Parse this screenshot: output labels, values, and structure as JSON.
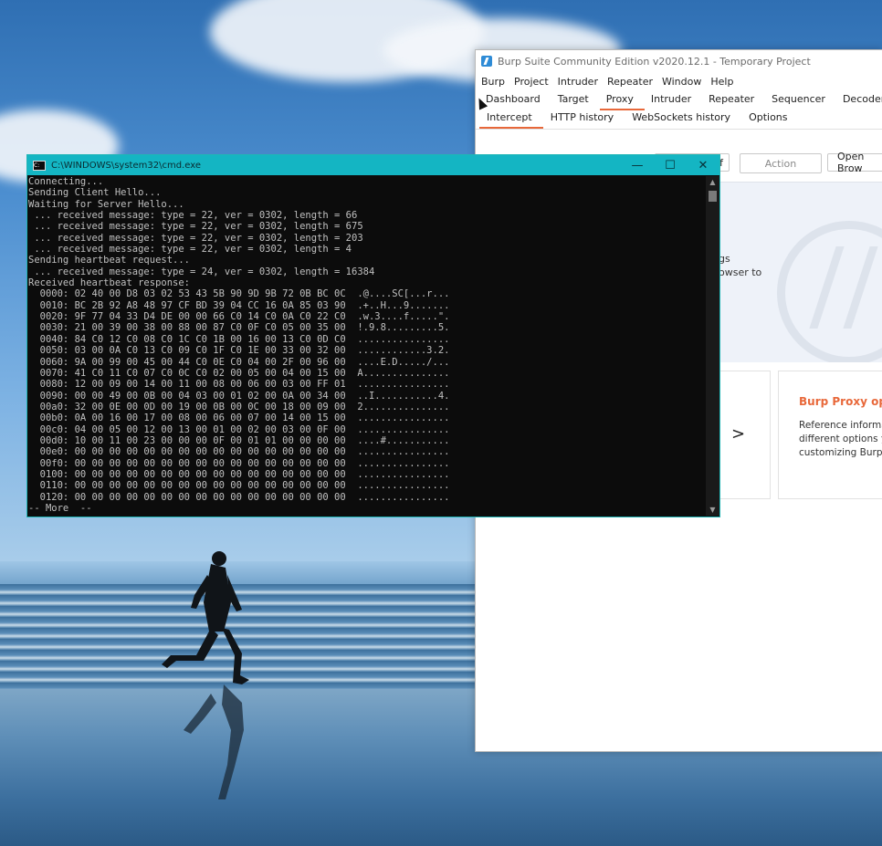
{
  "burp": {
    "title": "Burp Suite Community Edition v2020.12.1 - Temporary Project",
    "menu": [
      "Burp",
      "Project",
      "Intruder",
      "Repeater",
      "Window",
      "Help"
    ],
    "tabs": [
      "Dashboard",
      "Target",
      "Proxy",
      "Intruder",
      "Repeater",
      "Sequencer",
      "Decoder"
    ],
    "active_tab": "Proxy",
    "subtabs": [
      "Intercept",
      "HTTP history",
      "WebSockets history",
      "Options"
    ],
    "active_subtab": "Intercept",
    "toolbar": {
      "intercept_toggle": "ff",
      "action": "Action",
      "open_browser": "Open Brow"
    },
    "intercept_text": [
      "gs",
      "owser to"
    ],
    "card_arrow": ">",
    "card": {
      "title": "Burp Proxy optic",
      "body": [
        "Reference informati",
        "different options yo",
        "customizing Burp P"
      ]
    },
    "accent_color": "#e8683a"
  },
  "cmd": {
    "title": "C:\\WINDOWS\\system32\\cmd.exe",
    "controls": [
      "—",
      "☐",
      "✕"
    ],
    "lines": [
      "Connecting...",
      "Sending Client Hello...",
      "Waiting for Server Hello...",
      " ... received message: type = 22, ver = 0302, length = 66",
      " ... received message: type = 22, ver = 0302, length = 675",
      " ... received message: type = 22, ver = 0302, length = 203",
      " ... received message: type = 22, ver = 0302, length = 4",
      "Sending heartbeat request...",
      " ... received message: type = 24, ver = 0302, length = 16384",
      "Received heartbeat response:",
      "  0000: 02 40 00 D8 03 02 53 43 5B 90 9D 9B 72 0B BC 0C  .@....SC[...r...",
      "  0010: BC 2B 92 A8 48 97 CF BD 39 04 CC 16 0A 85 03 90  .+..H...9.......",
      "  0020: 9F 77 04 33 D4 DE 00 00 66 C0 14 C0 0A C0 22 C0  .w.3....f.....\".",
      "  0030: 21 00 39 00 38 00 88 00 87 C0 0F C0 05 00 35 00  !.9.8.........5.",
      "  0040: 84 C0 12 C0 08 C0 1C C0 1B 00 16 00 13 C0 0D C0  ................",
      "  0050: 03 00 0A C0 13 C0 09 C0 1F C0 1E 00 33 00 32 00  ............3.2.",
      "  0060: 9A 00 99 00 45 00 44 C0 0E C0 04 00 2F 00 96 00  ....E.D...../...",
      "  0070: 41 C0 11 C0 07 C0 0C C0 02 00 05 00 04 00 15 00  A...............",
      "  0080: 12 00 09 00 14 00 11 00 08 00 06 00 03 00 FF 01  ................",
      "  0090: 00 00 49 00 0B 00 04 03 00 01 02 00 0A 00 34 00  ..I...........4.",
      "  00a0: 32 00 0E 00 0D 00 19 00 0B 00 0C 00 18 00 09 00  2...............",
      "  00b0: 0A 00 16 00 17 00 08 00 06 00 07 00 14 00 15 00  ................",
      "  00c0: 04 00 05 00 12 00 13 00 01 00 02 00 03 00 0F 00  ................",
      "  00d0: 10 00 11 00 23 00 00 00 0F 00 01 01 00 00 00 00  ....#...........",
      "  00e0: 00 00 00 00 00 00 00 00 00 00 00 00 00 00 00 00  ................",
      "  00f0: 00 00 00 00 00 00 00 00 00 00 00 00 00 00 00 00  ................",
      "  0100: 00 00 00 00 00 00 00 00 00 00 00 00 00 00 00 00  ................",
      "  0110: 00 00 00 00 00 00 00 00 00 00 00 00 00 00 00 00  ................",
      "  0120: 00 00 00 00 00 00 00 00 00 00 00 00 00 00 00 00  ................",
      "-- More  --"
    ]
  }
}
